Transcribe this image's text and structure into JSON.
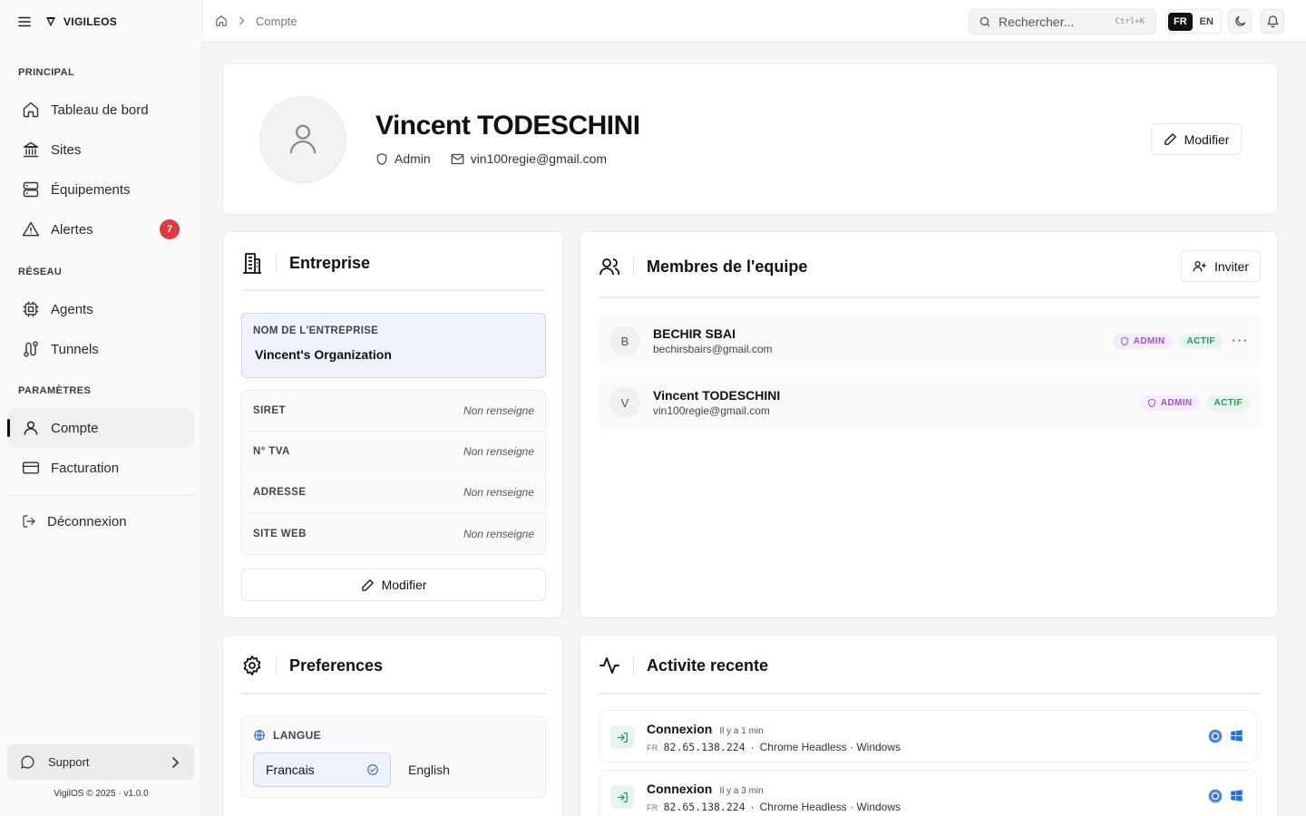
{
  "brand": {
    "name": "VIGILEOS"
  },
  "sidebar": {
    "sections": [
      {
        "label": "PRINCIPAL"
      },
      {
        "label": "RÉSEAU"
      },
      {
        "label": "PARAMÈTRES"
      }
    ],
    "items": [
      {
        "label": "Tableau de bord",
        "icon": "home-icon"
      },
      {
        "label": "Sites",
        "icon": "building-icon"
      },
      {
        "label": "Équipements",
        "icon": "server-icon"
      },
      {
        "label": "Alertes",
        "icon": "alert-triangle-icon",
        "badge": "7"
      },
      {
        "label": "Agents",
        "icon": "cpu-icon"
      },
      {
        "label": "Tunnels",
        "icon": "route-icon"
      },
      {
        "label": "Compte",
        "icon": "user-icon",
        "active": true
      },
      {
        "label": "Facturation",
        "icon": "credit-card-icon"
      }
    ],
    "logout": "Déconnexion",
    "support": "Support",
    "version": "VigilOS © 2025 · v1.0.0"
  },
  "topbar": {
    "breadcrumb": "Compte",
    "search_placeholder": "Rechercher...",
    "search_shortcut": "Ctrl+K",
    "lang_active": "FR",
    "lang_other": "EN"
  },
  "profile": {
    "name": "Vincent TODESCHINI",
    "role": "Admin",
    "email": "vin100regie@gmail.com",
    "edit_label": "Modifier"
  },
  "company": {
    "title": "Entreprise",
    "name_label": "NOM DE L'ENTREPRISE",
    "name_value": "Vincent's Organization",
    "fields": [
      {
        "key": "SIRET",
        "value": "Non renseigne"
      },
      {
        "key": "N° TVA",
        "value": "Non renseigne"
      },
      {
        "key": "ADRESSE",
        "value": "Non renseigne"
      },
      {
        "key": "SITE WEB",
        "value": "Non renseigne"
      }
    ],
    "edit_label": "Modifier"
  },
  "team": {
    "title": "Membres de l'equipe",
    "invite_label": "Inviter",
    "members": [
      {
        "initial": "B",
        "name": "BECHIR SBAI",
        "email": "bechirsbairs@gmail.com",
        "role": "ADMIN",
        "status": "ACTIF"
      },
      {
        "initial": "V",
        "name": "Vincent TODESCHINI",
        "email": "vin100regie@gmail.com",
        "role": "ADMIN",
        "status": "ACTIF"
      }
    ]
  },
  "preferences": {
    "title": "Preferences",
    "lang_label": "LANGUE",
    "options": [
      "Francais",
      "English"
    ],
    "selected": "Francais"
  },
  "activity": {
    "title": "Activite recente",
    "items": [
      {
        "title": "Connexion",
        "ago": "Il y a 1 min",
        "country": "FR",
        "ip": "82.65.138.224",
        "client": "Chrome Headless · Windows"
      },
      {
        "title": "Connexion",
        "ago": "Il y a 3 min",
        "country": "FR",
        "ip": "82.65.138.224",
        "client": "Chrome Headless · Windows"
      }
    ]
  },
  "colors": {
    "accent": "#111111",
    "alert": "#e03a3a",
    "admin": "#a24fd6",
    "active": "#1f9a5a",
    "highlight": "#eef2fb"
  }
}
